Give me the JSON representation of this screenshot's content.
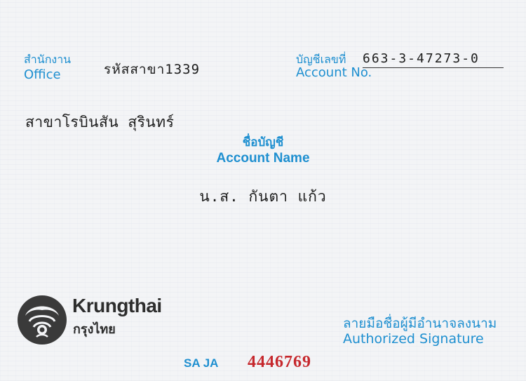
{
  "office": {
    "label_th": "สำนักงาน",
    "label_en": "Office",
    "value": "รหัสสาขา1339"
  },
  "account_no": {
    "label_th": "บัญชีเลขที่",
    "label_en": "Account No.",
    "value": "663-3-47273-0"
  },
  "branch": {
    "value": "สาขาโรบินสัน สุรินทร์"
  },
  "account_name": {
    "label_th": "ชื่อบัญชี",
    "label_en": "Account Name",
    "value": "น.ส. กันตา แก้ว"
  },
  "brand": {
    "name_en": "Krungthai",
    "name_th": "กรุงไทย",
    "logo_icon": "krungthai-bird-logo"
  },
  "signature": {
    "label_th": "ลายมือชื่อผู้มีอำนาจลงนาม",
    "label_en": "Authorized Signature"
  },
  "serial": {
    "label": "SA JA",
    "number": "4446769"
  },
  "colors": {
    "label_blue": "#1e8fd0",
    "serial_red": "#c6282d",
    "typed_text": "#1c1c1c"
  }
}
